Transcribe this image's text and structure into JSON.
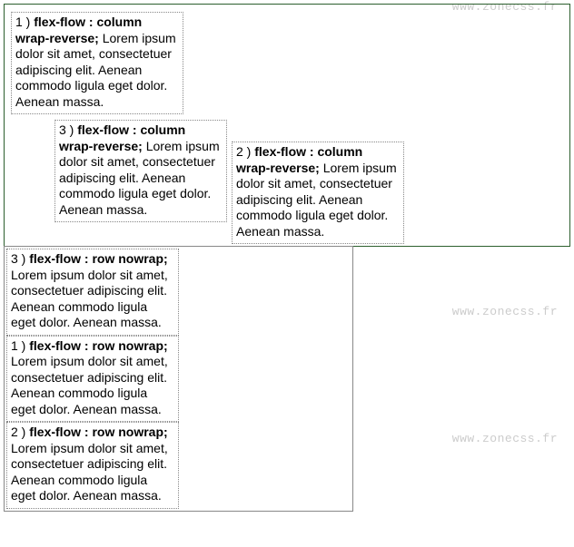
{
  "watermarks": {
    "w1": "www.zonecss.fr",
    "w2": "www.zonecss.fr",
    "w3": "www.zonecss.fr"
  },
  "top": {
    "items": [
      {
        "num": "3 ) ",
        "prop": "flex-flow : column wrap-reverse;",
        "body": " Lorem ipsum dolor sit amet, consectetuer adipiscing elit. Aenean commodo ligula eget dolor. Aenean massa."
      },
      {
        "num": "2 ) ",
        "prop": "flex-flow : column wrap-reverse;",
        "body": " Lorem ipsum dolor sit amet, consectetuer adipiscing elit. Aenean commodo ligula eget dolor. Aenean massa."
      },
      {
        "num": "1 ) ",
        "prop": "flex-flow : column wrap-reverse;",
        "body": " Lorem ipsum dolor sit amet, consectetuer adipiscing elit. Aenean commodo ligula eget dolor. Aenean massa."
      }
    ]
  },
  "bottom": {
    "items": [
      {
        "num": "3 ) ",
        "prop": "flex-flow : row nowrap;",
        "body": " Lorem ipsum dolor sit amet, consectetuer adipiscing elit. Aenean commodo ligula eget dolor. Aenean massa."
      },
      {
        "num": "1 ) ",
        "prop": "flex-flow : row nowrap;",
        "body": " Lorem ipsum dolor sit amet, consectetuer adipiscing elit. Aenean commodo ligula eget dolor. Aenean massa."
      },
      {
        "num": "2 ) ",
        "prop": "flex-flow : row nowrap;",
        "body": " Lorem ipsum dolor sit amet, consectetuer adipiscing elit. Aenean commodo ligula eget dolor. Aenean massa."
      }
    ]
  }
}
